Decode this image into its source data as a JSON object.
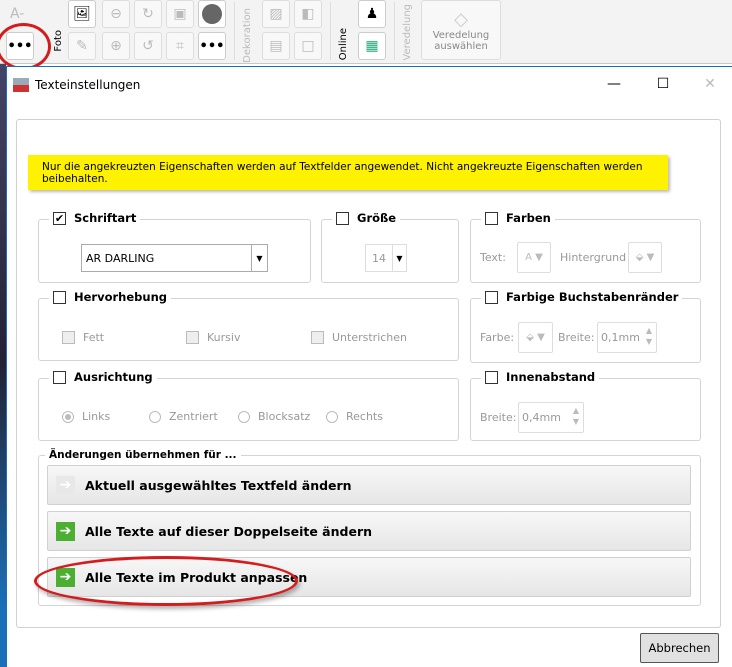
{
  "toolbar": {
    "text_minus": "A-",
    "more_label": "•••",
    "foto_label": "Foto",
    "dekoration_label": "Dekoration",
    "online_label": "Online",
    "veredelung_label": "Veredelung",
    "veredelung_button": "Veredelung auswählen"
  },
  "dialog": {
    "title": "Texteinstellungen",
    "notice": "Nur die angekreuzten Eigenschaften werden auf Textfelder angewendet. Nicht angekreuzte Eigenschaften werden beibehalten.",
    "schriftart": {
      "label": "Schriftart",
      "checked": true,
      "value": "AR DARLING"
    },
    "groesse": {
      "label": "Größe",
      "checked": false,
      "value": "14"
    },
    "farben": {
      "label": "Farben",
      "checked": false,
      "text_label": "Text:",
      "hintergrund_label": "Hintergrund"
    },
    "hervorhebung": {
      "label": "Hervorhebung",
      "checked": false,
      "options": [
        "Fett",
        "Kursiv",
        "Unterstrichen"
      ]
    },
    "buchstabenraender": {
      "label": "Farbige Buchstabenränder",
      "checked": false,
      "farbe_label": "Farbe:",
      "breite_label": "Breite:",
      "breite_value": "0,1mm"
    },
    "ausrichtung": {
      "label": "Ausrichtung",
      "checked": false,
      "options": [
        "Links",
        "Zentriert",
        "Blocksatz",
        "Rechts"
      ],
      "selected": "Links"
    },
    "innenabstand": {
      "label": "Innenabstand",
      "checked": false,
      "breite_label": "Breite:",
      "breite_value": "0,4mm"
    },
    "apply": {
      "label": "Änderungen übernehmen für ...",
      "buttons": [
        "Aktuell ausgewähltes Textfeld ändern",
        "Alle Texte auf dieser Doppelseite ändern",
        "Alle Texte im Produkt anpassen"
      ]
    },
    "cancel": "Abbrechen"
  },
  "colors": {
    "notice_bg": "#fef200",
    "arrow_green": "#4caf32",
    "highlight_red": "#d41c1c"
  }
}
